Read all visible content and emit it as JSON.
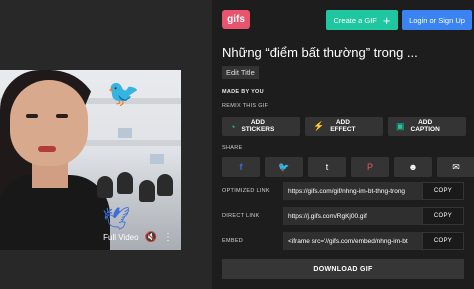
{
  "preview": {
    "video_title": "Full Video",
    "mute_icon": "mute-icon",
    "more_icon": "more-vertical-icon"
  },
  "header": {
    "logo": "gifs",
    "create_label": "Create a GIF",
    "create_icon": "plus-icon",
    "login_label": "Login or Sign Up"
  },
  "gif": {
    "title": "Những “điểm bất thường” trong ...",
    "edit_title_label": "Edit Title",
    "made_by_label": "MADE BY YOU"
  },
  "remix": {
    "label": "REMIX THIS GIF",
    "buttons": [
      {
        "line1": "ADD",
        "line2": "STICKERS",
        "icon": "sticker-icon"
      },
      {
        "line1": "ADD",
        "line2": "EFFECT",
        "icon": "effect-icon"
      },
      {
        "line1": "ADD",
        "line2": "CAPTION",
        "icon": "caption-icon"
      }
    ]
  },
  "share": {
    "label": "SHARE",
    "buttons": [
      {
        "icon": "facebook-icon",
        "glyph": "f"
      },
      {
        "icon": "twitter-icon",
        "glyph": "🐦"
      },
      {
        "icon": "tumblr-icon",
        "glyph": "t"
      },
      {
        "icon": "pinterest-icon",
        "glyph": "P"
      },
      {
        "icon": "reddit-icon",
        "glyph": "☻"
      },
      {
        "icon": "email-icon",
        "glyph": "✉"
      }
    ]
  },
  "links": [
    {
      "label": "OPTIMIZED LINK",
      "value": "https://gifs.com/gif/nhng-im-bt-thng-trong",
      "copy": "COPY"
    },
    {
      "label": "DIRECT LINK",
      "value": "https://j.gifs.com/RgKj00.gif",
      "copy": "COPY"
    },
    {
      "label": "EMBED",
      "value": "<iframe src='//gifs.com/embed/nhng-im-bt",
      "copy": "COPY"
    }
  ],
  "download_label": "DOWNLOAD GIF",
  "colors": {
    "accent_green": "#1ec7a0",
    "accent_blue": "#3a83f1",
    "logo_pink": "#e8546e"
  }
}
